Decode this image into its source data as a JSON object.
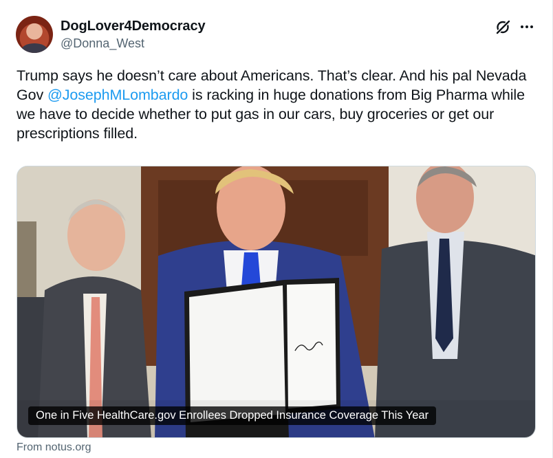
{
  "post": {
    "display_name": "DogLover4Democracy",
    "handle": "@Donna_West",
    "text_before": "Trump says he doesn’t care about Americans. That’s clear. And his pal Nevada Gov ",
    "mention": "@JosephMLombardo",
    "text_after": " is racking in huge donations from Big Pharma while we have to decide whether to put gas in our cars, buy groceries or get our prescriptions filled."
  },
  "card": {
    "title": "One in Five HealthCare.gov Enrollees Dropped Insurance Coverage This Year",
    "source": "From notus.org"
  },
  "colors": {
    "link": "#1d9bf0",
    "secondary_text": "#536471",
    "primary_text": "#0f1419"
  },
  "icons": {
    "grok": "grok-icon",
    "more": "more-icon"
  }
}
